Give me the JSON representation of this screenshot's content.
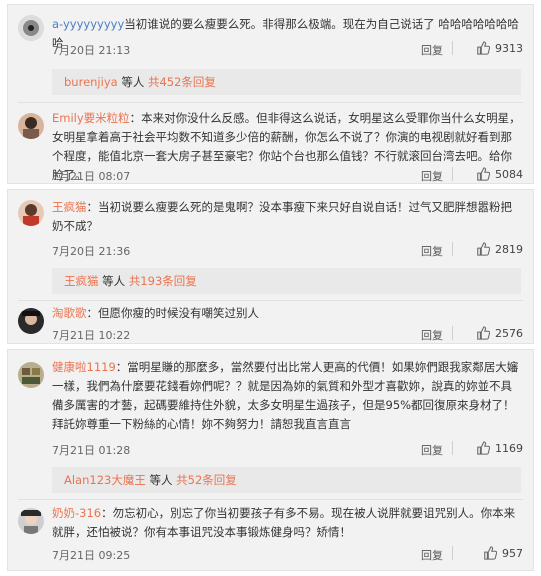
{
  "groups": [
    {
      "top_comment": {
        "user": "a-yyyyyyyyy",
        "text": "当初谁说的要么瘦要么死。非得那么极端。现在为自己说话了 哈哈哈哈哈哈哈哈",
        "time": "7月20日 21:13",
        "reply": "回复",
        "likes": "9313"
      },
      "thread": {
        "user": "burenjiya",
        "middle": " 等人 ",
        "count": "共452条回复"
      },
      "reply_comment": {
        "user": "Emily要米粒粒",
        "text": "：本来对你没什么反感。但非得这么说话，女明星这么受罪你当什么女明星，女明星拿着高于社会平均数不知道多少倍的薪酬，你怎么不说了？你演的电视剧就好看到那个程度，能值北京一套大房子甚至豪宅？你站个台也那么值钱？不行就滚回台湾去吧。给你脸了。",
        "time": "7月21日 08:07",
        "reply": "回复",
        "likes": "5084"
      }
    },
    {
      "top_comment": {
        "user": "王疯猫",
        "text": "：当初说要么瘦要么死的是鬼啊？没本事瘦下来只好自说自话！过气又肥胖想嚣粉把奶不成？",
        "time": "7月20日 21:36",
        "reply": "回复",
        "likes": "2819"
      },
      "thread": {
        "user": "王疯猫",
        "middle": " 等人 ",
        "count": "共193条回复"
      },
      "reply_comment": {
        "user": "淘歌歌",
        "text": "：但愿你瘦的时候没有嘲笑过别人",
        "time": "7月21日 10:22",
        "reply": "回复",
        "likes": "2576"
      }
    },
    {
      "top_comment": {
        "user": "健康啦1119",
        "text": "：當明星賺的那麼多，當然要付出比常人更高的代價！如果妳們跟我家鄰居大嬸一樣，我們為什麼要花錢看妳們呢？？就是因為妳的氣質和外型才喜歡妳，說真的妳並不具備多厲害的才藝，起碼要維持住外貌，太多女明星生過孩子，但是95%都回復原來身材了！拜託妳尊重一下粉絲的心情！妳不夠努力！請恕我直言直言",
        "time": "7月21日 01:28",
        "reply": "回复",
        "likes": "1169"
      },
      "thread": {
        "user": "Alan123大魔王",
        "middle": " 等人 ",
        "count": "共52条回复"
      },
      "reply_comment": {
        "user": "奶奶-316",
        "text": "：勿忘初心，別忘了你当初要孩子有多不易。现在被人说胖就要诅咒别人。你本来就胖，还怕被说？你有本事诅咒没本事锻炼健身吗？矫情！",
        "time": "7月21日 09:25",
        "reply": "回复",
        "likes": "957"
      }
    }
  ],
  "colors": {
    "username": "#eb7350",
    "card_bg": "#f2f2f2",
    "subbox_bg": "#e9e9e9"
  },
  "icons": {
    "like": "thumbs-up-icon"
  }
}
